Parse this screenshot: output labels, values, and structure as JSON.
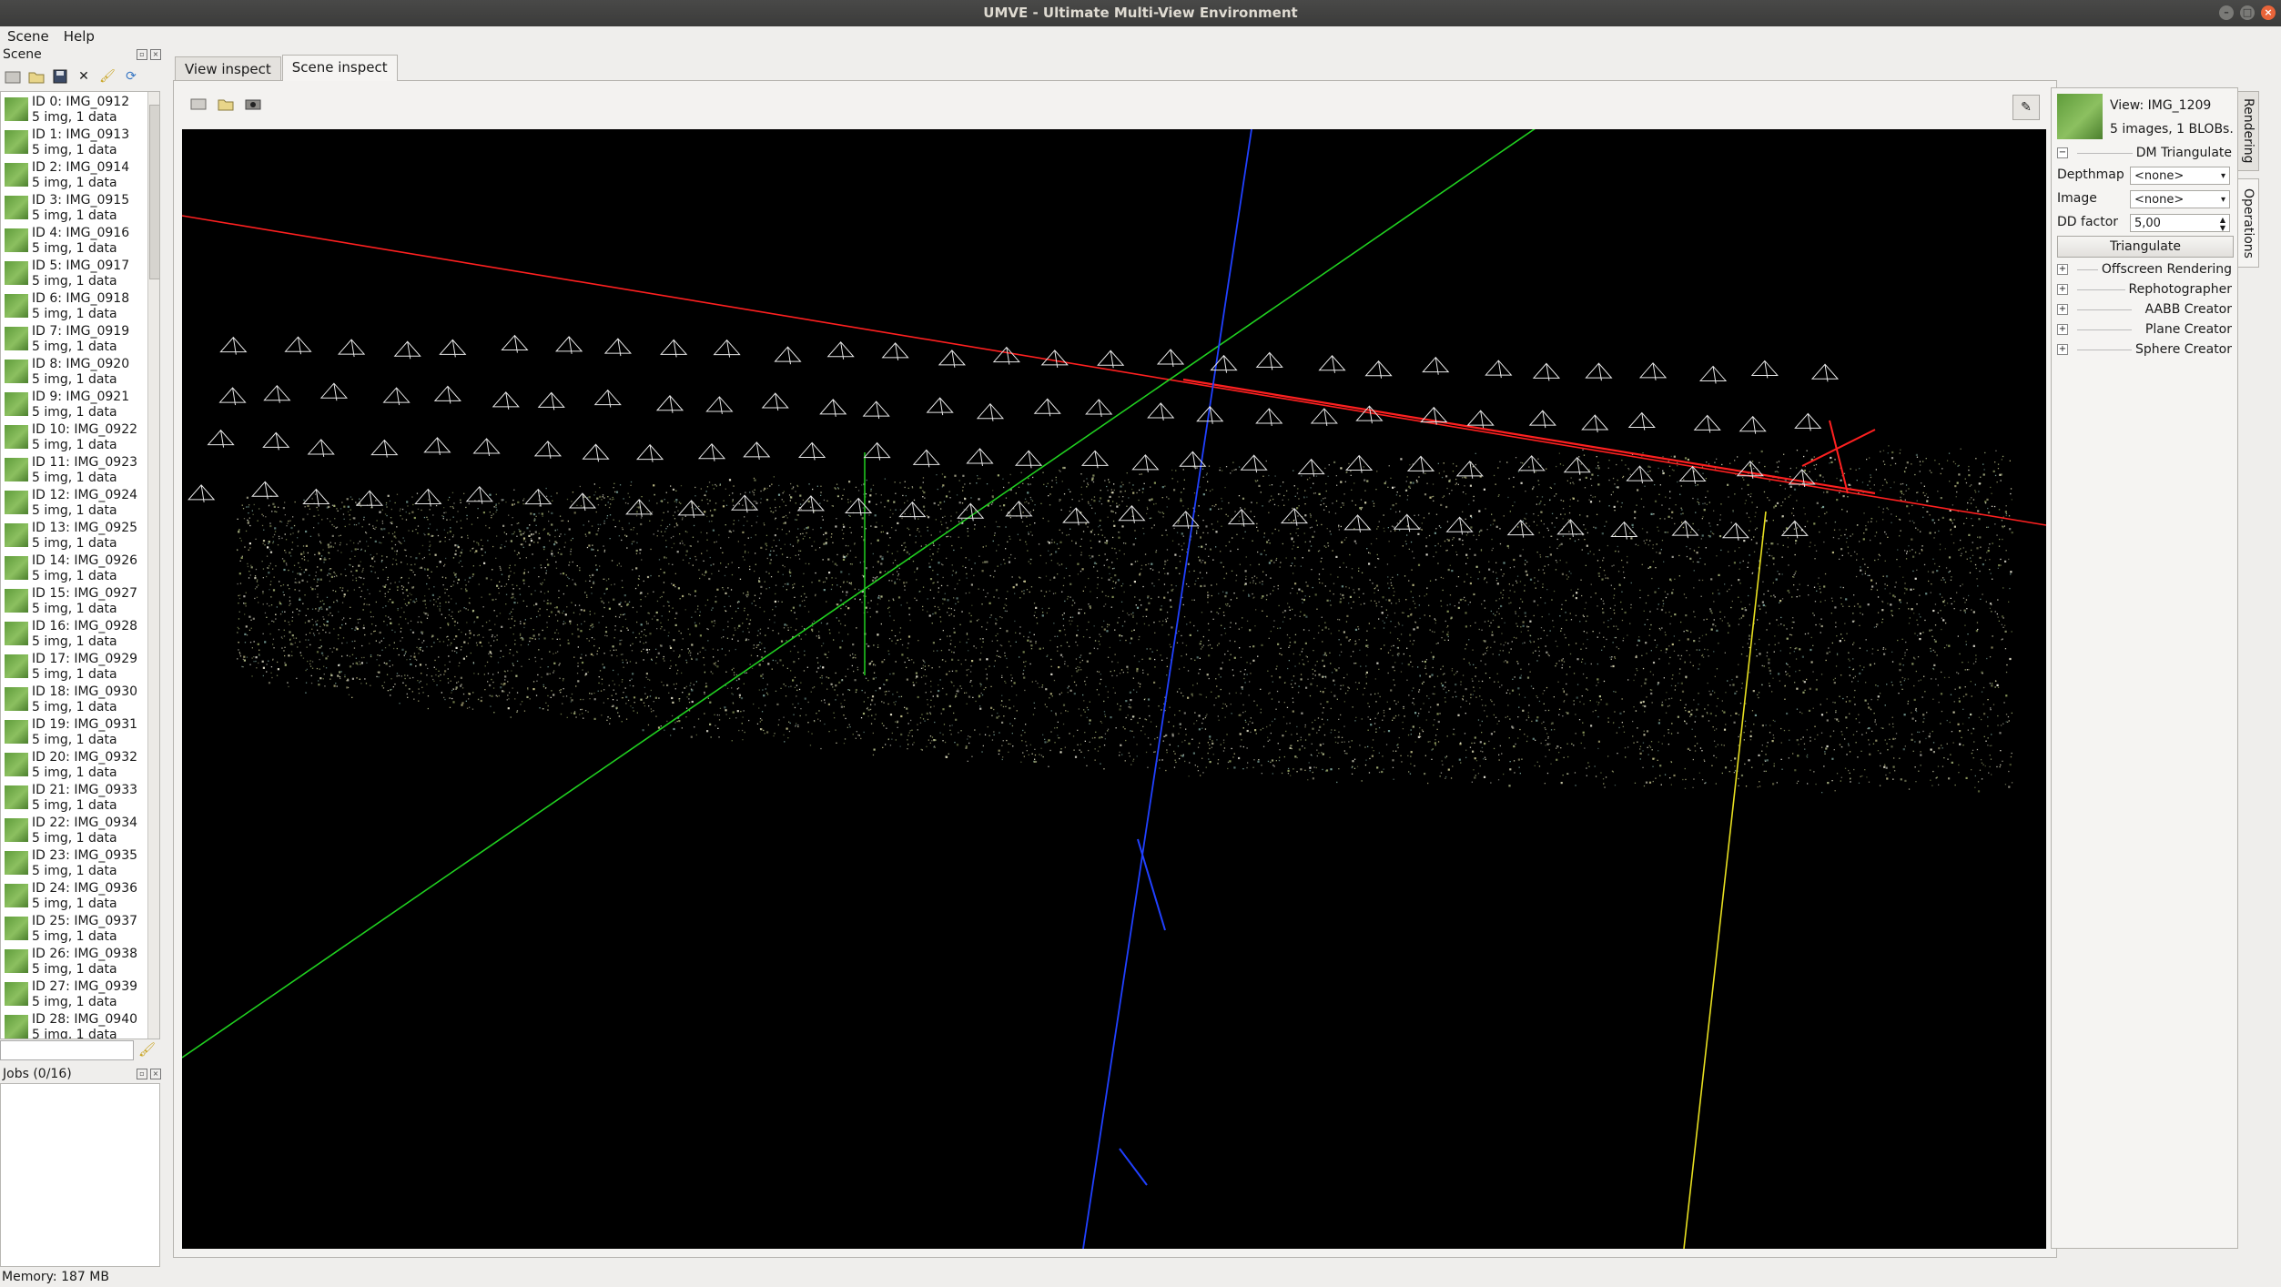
{
  "window": {
    "title": "UMVE - Ultimate Multi-View Environment"
  },
  "menu": [
    {
      "label": "Scene"
    },
    {
      "label": "Help"
    }
  ],
  "scene_panel": {
    "title": "Scene"
  },
  "views": [
    {
      "id": "ID 0: IMG_0912",
      "info": "5 img, 1 data"
    },
    {
      "id": "ID 1: IMG_0913",
      "info": "5 img, 1 data"
    },
    {
      "id": "ID 2: IMG_0914",
      "info": "5 img, 1 data"
    },
    {
      "id": "ID 3: IMG_0915",
      "info": "5 img, 1 data"
    },
    {
      "id": "ID 4: IMG_0916",
      "info": "5 img, 1 data"
    },
    {
      "id": "ID 5: IMG_0917",
      "info": "5 img, 1 data"
    },
    {
      "id": "ID 6: IMG_0918",
      "info": "5 img, 1 data"
    },
    {
      "id": "ID 7: IMG_0919",
      "info": "5 img, 1 data"
    },
    {
      "id": "ID 8: IMG_0920",
      "info": "5 img, 1 data"
    },
    {
      "id": "ID 9: IMG_0921",
      "info": "5 img, 1 data"
    },
    {
      "id": "ID 10: IMG_0922",
      "info": "5 img, 1 data"
    },
    {
      "id": "ID 11: IMG_0923",
      "info": "5 img, 1 data"
    },
    {
      "id": "ID 12: IMG_0924",
      "info": "5 img, 1 data"
    },
    {
      "id": "ID 13: IMG_0925",
      "info": "5 img, 1 data"
    },
    {
      "id": "ID 14: IMG_0926",
      "info": "5 img, 1 data"
    },
    {
      "id": "ID 15: IMG_0927",
      "info": "5 img, 1 data"
    },
    {
      "id": "ID 16: IMG_0928",
      "info": "5 img, 1 data"
    },
    {
      "id": "ID 17: IMG_0929",
      "info": "5 img, 1 data"
    },
    {
      "id": "ID 18: IMG_0930",
      "info": "5 img, 1 data"
    },
    {
      "id": "ID 19: IMG_0931",
      "info": "5 img, 1 data"
    },
    {
      "id": "ID 20: IMG_0932",
      "info": "5 img, 1 data"
    },
    {
      "id": "ID 21: IMG_0933",
      "info": "5 img, 1 data"
    },
    {
      "id": "ID 22: IMG_0934",
      "info": "5 img, 1 data"
    },
    {
      "id": "ID 23: IMG_0935",
      "info": "5 img, 1 data"
    },
    {
      "id": "ID 24: IMG_0936",
      "info": "5 img, 1 data"
    },
    {
      "id": "ID 25: IMG_0937",
      "info": "5 img, 1 data"
    },
    {
      "id": "ID 26: IMG_0938",
      "info": "5 img, 1 data"
    },
    {
      "id": "ID 27: IMG_0939",
      "info": "5 img, 1 data"
    },
    {
      "id": "ID 28: IMG_0940",
      "info": "5 img, 1 data"
    }
  ],
  "jobs_panel": {
    "title": "Jobs (0/16)"
  },
  "status": {
    "memory": "Memory: 187 MB"
  },
  "tabs": [
    {
      "label": "View inspect"
    },
    {
      "label": "Scene inspect"
    }
  ],
  "right_panel": {
    "view_name": "View: IMG_1209",
    "view_info": "5 images, 1 BLOBs.",
    "dm_triangulate": {
      "title": "DM Triangulate",
      "depthmap_label": "Depthmap",
      "depthmap_value": "<none>",
      "image_label": "Image",
      "image_value": "<none>",
      "dd_factor_label": "DD factor",
      "dd_factor_value": "5,00",
      "button": "Triangulate"
    },
    "groups": [
      {
        "label": "Offscreen Rendering"
      },
      {
        "label": "Rephotographer"
      },
      {
        "label": "AABB Creator"
      },
      {
        "label": "Plane Creator"
      },
      {
        "label": "Sphere Creator"
      }
    ],
    "vertical_tabs": [
      {
        "label": "Rendering"
      },
      {
        "label": "Operations"
      }
    ]
  },
  "colors": {
    "x_axis": "#ff2020",
    "y_axis": "#20d020",
    "z_axis": "#2040ff",
    "aux_axis": "#e8e020"
  }
}
